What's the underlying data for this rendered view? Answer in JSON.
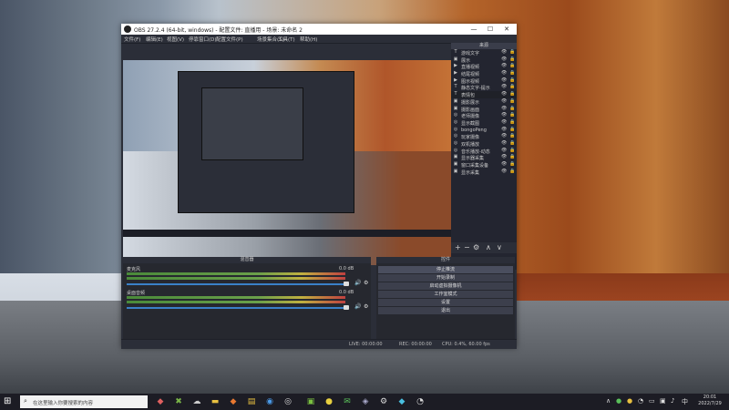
{
  "window": {
    "title": "OBS 27.2.4 (64-bit, windows) - 配置文件: 直播用 - 场景: 未命名 2",
    "min_label": "—",
    "max_label": "☐",
    "close_label": "✕"
  },
  "menu": [
    "文件(F)",
    "编辑(E)",
    "视图(V)",
    "停靠窗口(D)",
    "配置文件(P)",
    "场景集合(S)",
    "工具(T)",
    "帮助(H)"
  ],
  "sources": {
    "title": "来源",
    "items": [
      {
        "icon": "T",
        "name": "游戏文字"
      },
      {
        "icon": "▣",
        "name": "展示"
      },
      {
        "icon": "▶",
        "name": "直播视频"
      },
      {
        "icon": "▶",
        "name": "结尾视频"
      },
      {
        "icon": "▶",
        "name": "图示视频"
      },
      {
        "icon": "T",
        "name": "静态文字-提示"
      },
      {
        "icon": "T",
        "name": "表情包"
      },
      {
        "icon": "▣",
        "name": "摄影展示"
      },
      {
        "icon": "▣",
        "name": "摄影画面"
      },
      {
        "icon": "◎",
        "name": "老师摄像"
      },
      {
        "icon": "◎",
        "name": "显示截图"
      },
      {
        "icon": "◎",
        "name": "bongoPeng"
      },
      {
        "icon": "◎",
        "name": "玩家摄像"
      },
      {
        "icon": "◎",
        "name": "双机播放"
      },
      {
        "icon": "◎",
        "name": "音乐播放-动态"
      },
      {
        "icon": "▣",
        "name": "显示器采集"
      },
      {
        "icon": "▣",
        "name": "窗口采集设备"
      },
      {
        "icon": "▣",
        "name": "显示采集"
      }
    ],
    "selected_index": 6,
    "toolbar": [
      "+",
      "−",
      "⚙",
      "∧",
      "∨"
    ]
  },
  "mixer": {
    "title": "混音器",
    "tracks": [
      {
        "name": "麦克风",
        "db": "0.0 dB"
      },
      {
        "name": "桌面音频",
        "db": "0.0 dB"
      }
    ]
  },
  "controls": {
    "title": "控件",
    "buttons": [
      "停止推流",
      "开始录制",
      "启动虚拟摄像机",
      "工作室模式",
      "设置",
      "退出"
    ]
  },
  "status": {
    "live": "LIVE: 00:00:00",
    "rec": "REC: 00:00:00",
    "cpu": "CPU: 0.4%, 60.00 fps"
  },
  "taskbar": {
    "search_placeholder": "在这里输入你要搜索的内容",
    "time": "20:01",
    "date": "2022/7/29"
  }
}
